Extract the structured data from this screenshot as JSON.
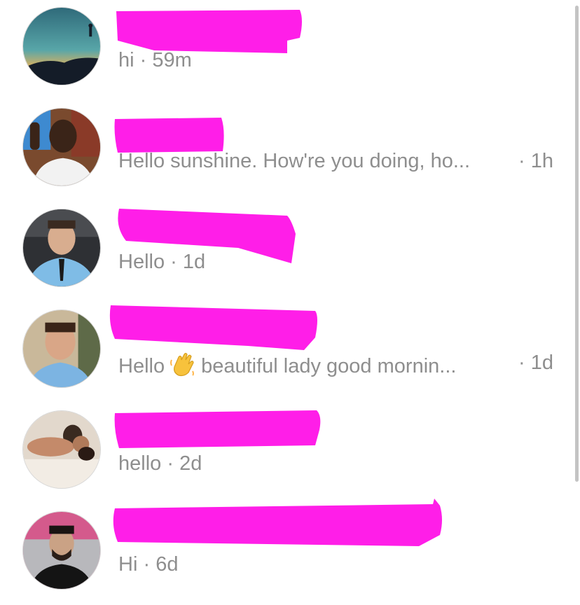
{
  "conversations": [
    {
      "preview": "hi",
      "time": "59m"
    },
    {
      "preview": "Hello sunshine. How're you doing, ho...",
      "time": "1h"
    },
    {
      "preview": "Hello",
      "time": "1d"
    },
    {
      "preview_before": "Hello",
      "preview_after": "beautiful lady good mornin...",
      "time": "1d",
      "emoji": "waving-hand-icon"
    },
    {
      "preview": "hello",
      "time": "2d"
    },
    {
      "preview": "Hi",
      "time": "6d"
    }
  ],
  "separator": "·",
  "colors": {
    "redaction": "#ff1ee8",
    "secondary_text": "#8e8e8e",
    "background": "#ffffff"
  }
}
